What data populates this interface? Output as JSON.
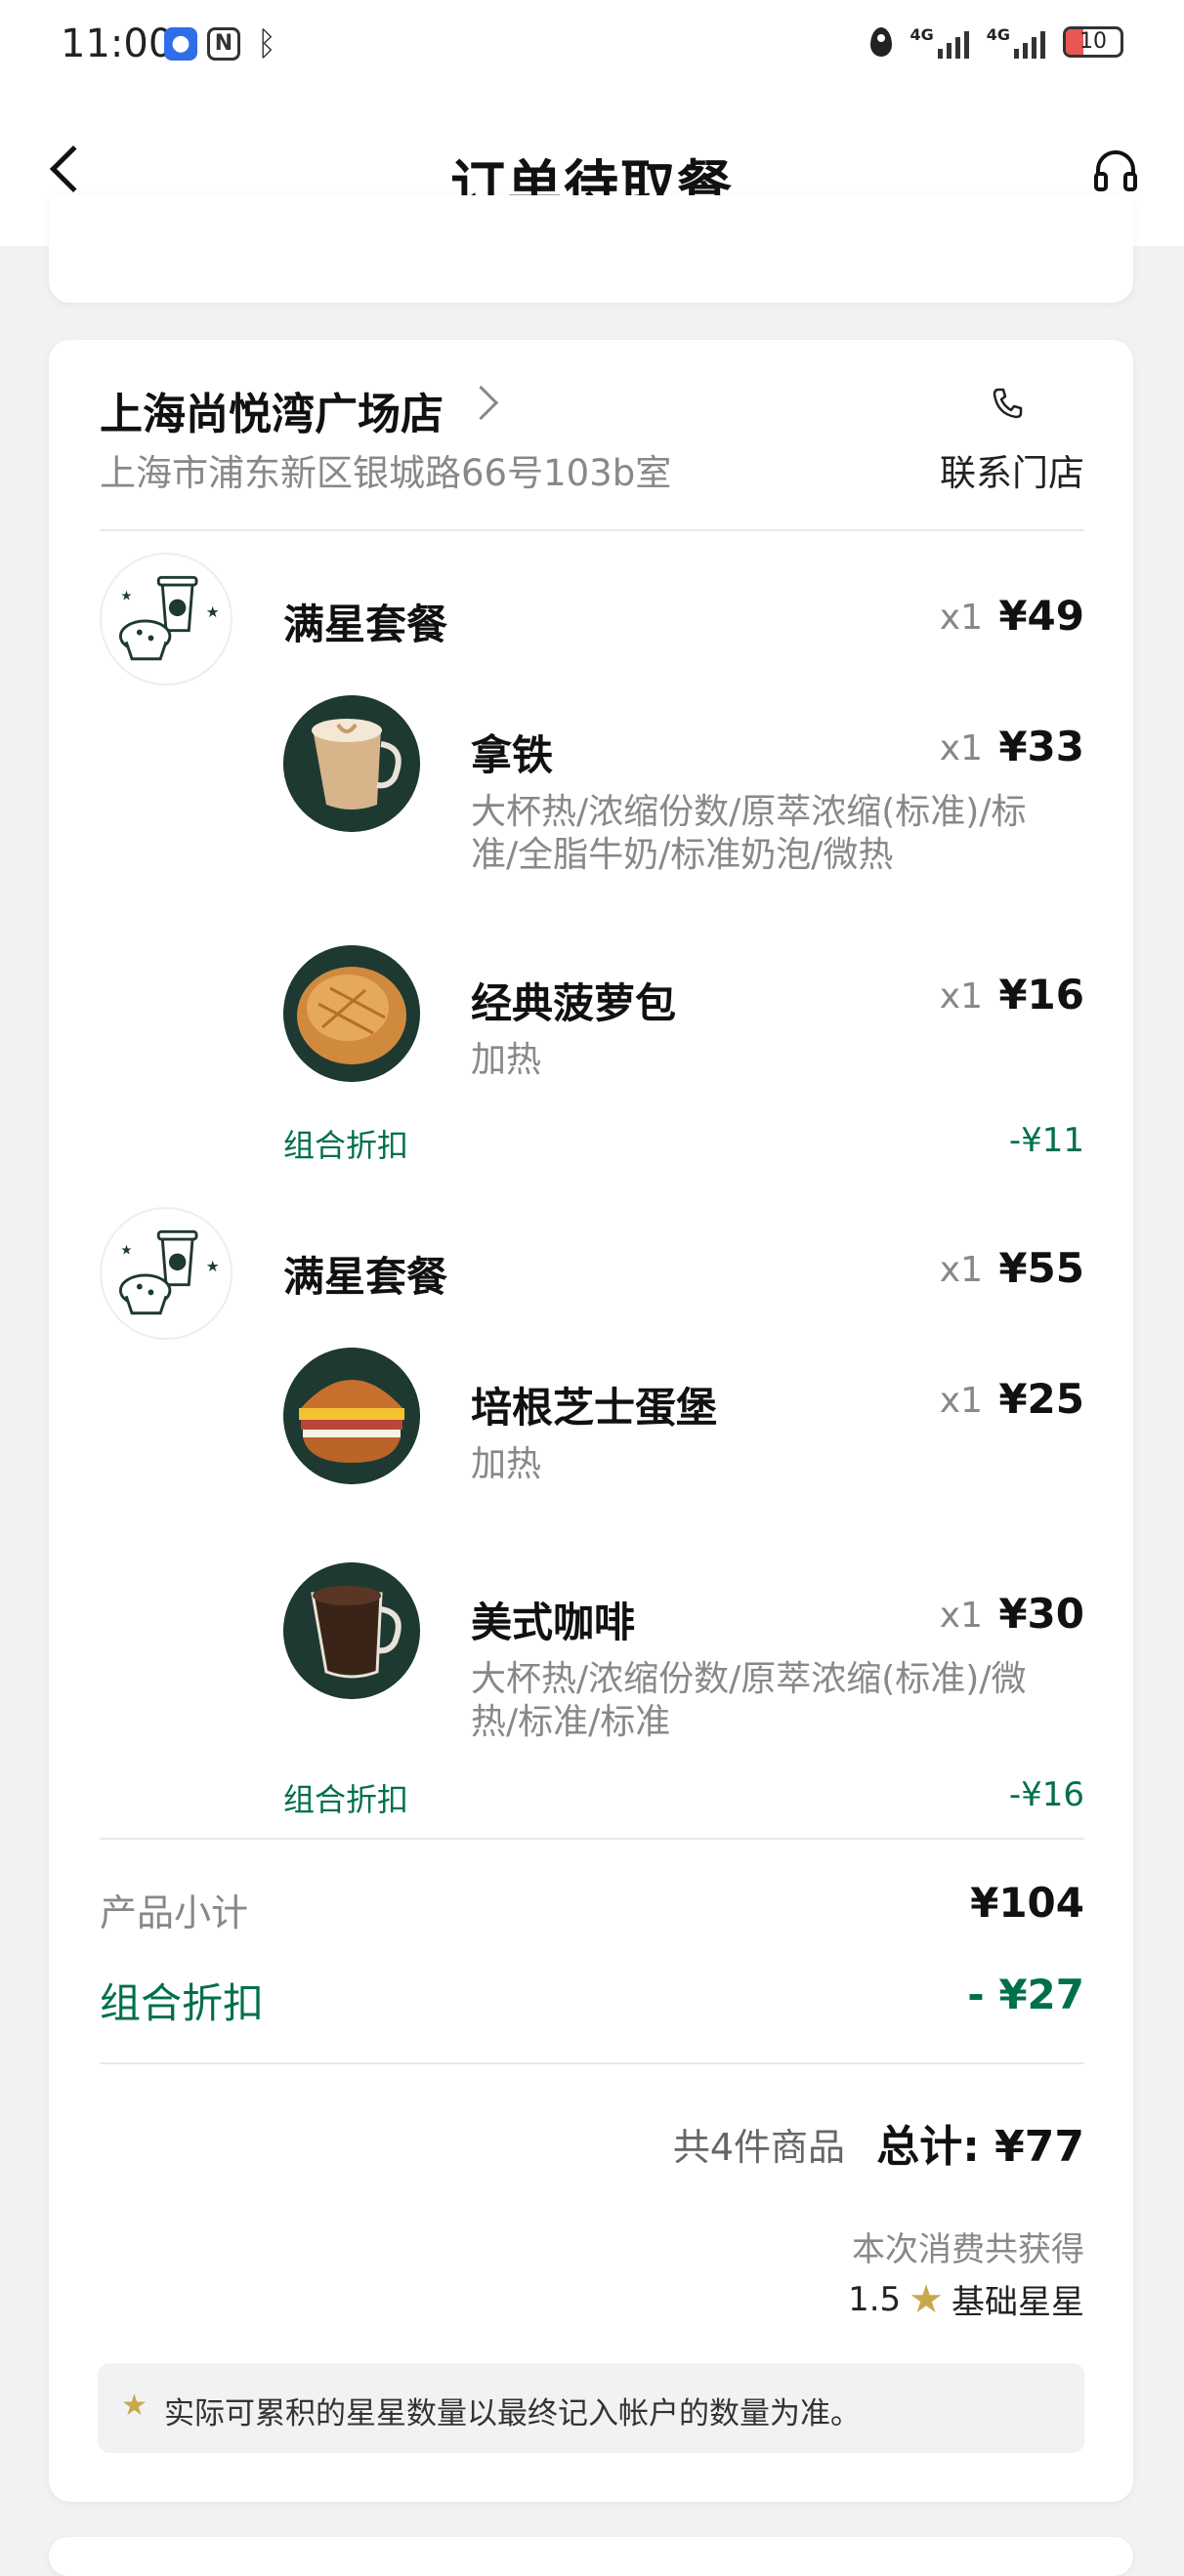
{
  "status": {
    "time": "11:00",
    "net1": "4G",
    "net2": "4G",
    "battery": "10"
  },
  "header": {
    "title": "订单待取餐"
  },
  "store": {
    "name": "上海尚悦湾广场店",
    "address": "上海市浦东新区银城路66号103b室",
    "contact_label": "联系门店"
  },
  "combos": [
    {
      "title": "满星套餐",
      "qty": "x1",
      "price": "¥49",
      "items": [
        {
          "name": "拿铁",
          "qty": "x1",
          "price": "¥33",
          "desc_line1": "大杯热/浓缩份数/原萃浓缩(标准)/标",
          "desc_line2": "准/全脂牛奶/标准奶泡/微热"
        },
        {
          "name": "经典菠萝包",
          "qty": "x1",
          "price": "¥16",
          "desc_line1": "加热"
        }
      ],
      "discount_label": "组合折扣",
      "discount_value": "-¥11"
    },
    {
      "title": "满星套餐",
      "qty": "x1",
      "price": "¥55",
      "items": [
        {
          "name": "培根芝士蛋堡",
          "qty": "x1",
          "price": "¥25",
          "desc_line1": "加热"
        },
        {
          "name": "美式咖啡",
          "qty": "x1",
          "price": "¥30",
          "desc_line1": "大杯热/浓缩份数/原萃浓缩(标准)/微",
          "desc_line2": "热/标准/标准"
        }
      ],
      "discount_label": "组合折扣",
      "discount_value": "-¥16"
    }
  ],
  "summary": {
    "subtotal_label": "产品小计",
    "subtotal_value": "¥104",
    "discount_label": "组合折扣",
    "discount_value": "- ¥27",
    "count_text": "共4件商品",
    "total_text": "总计: ¥77",
    "earn_label": "本次消费共获得",
    "earn_amount": "1.5",
    "earn_unit": "基础星星",
    "notice": "实际可累积的星星数量以最终记入帐户的数量为准。"
  },
  "colors": {
    "accent": "#00704a",
    "star": "#c9a84c",
    "brand_dark": "#1e3932"
  }
}
